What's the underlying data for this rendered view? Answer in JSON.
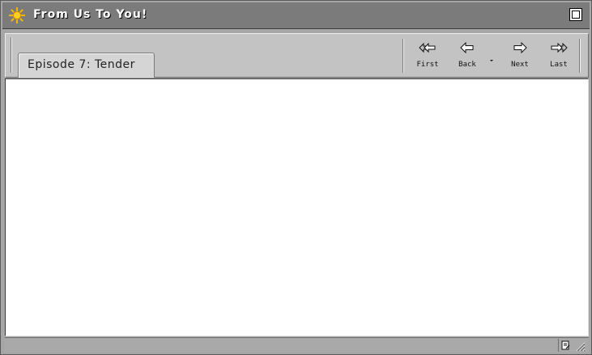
{
  "window": {
    "title": "From Us To You!",
    "title_icon": "sun-icon",
    "zoom_icon": "zoom-box-icon"
  },
  "tab": {
    "label": "Episode 7: Tender"
  },
  "navigation": {
    "buttons": [
      {
        "label": "First",
        "icon": "first-arrow-icon"
      },
      {
        "label": "Back",
        "icon": "back-arrow-icon"
      },
      {
        "label": "Next",
        "icon": "next-arrow-icon"
      },
      {
        "label": "Last",
        "icon": "last-arrow-icon"
      }
    ],
    "history_dropdown_icon": "dropdown-arrow-icon"
  },
  "statusbar": {
    "document_icon": "document-icon",
    "resize_icon": "resize-grip-icon"
  },
  "colors": {
    "titlebar": "#7b7b7b",
    "toolbar": "#c3c3c3",
    "content_background": "#ffffff",
    "sun_icon": "#f5b800"
  }
}
